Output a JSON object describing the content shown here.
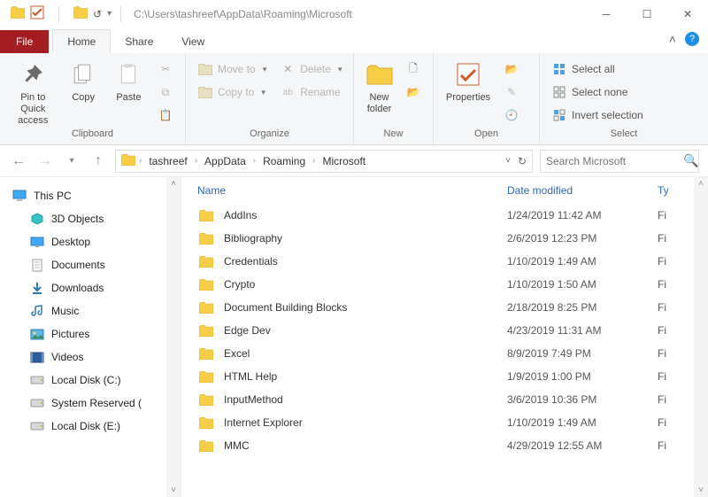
{
  "title_path": "C:\\Users\\tashreef\\AppData\\Roaming\\Microsoft",
  "tabs": {
    "file": "File",
    "home": "Home",
    "share": "Share",
    "view": "View"
  },
  "ribbon": {
    "clipboard": {
      "label": "Clipboard",
      "pin": "Pin to Quick access",
      "copy": "Copy",
      "paste": "Paste"
    },
    "organize": {
      "label": "Organize",
      "moveto": "Move to",
      "copyto": "Copy to",
      "delete": "Delete",
      "rename": "Rename"
    },
    "new": {
      "label": "New",
      "newfolder": "New folder"
    },
    "open": {
      "label": "Open",
      "properties": "Properties"
    },
    "select": {
      "label": "Select",
      "all": "Select all",
      "none": "Select none",
      "invert": "Invert selection"
    }
  },
  "breadcrumb": [
    "tashreef",
    "AppData",
    "Roaming",
    "Microsoft"
  ],
  "search_placeholder": "Search Microsoft",
  "navpane": [
    {
      "label": "This PC",
      "icon": "pc"
    },
    {
      "label": "3D Objects",
      "icon": "3d"
    },
    {
      "label": "Desktop",
      "icon": "desktop"
    },
    {
      "label": "Documents",
      "icon": "docs"
    },
    {
      "label": "Downloads",
      "icon": "downloads"
    },
    {
      "label": "Music",
      "icon": "music"
    },
    {
      "label": "Pictures",
      "icon": "pictures"
    },
    {
      "label": "Videos",
      "icon": "videos"
    },
    {
      "label": "Local Disk (C:)",
      "icon": "disk"
    },
    {
      "label": "System Reserved (",
      "icon": "disk"
    },
    {
      "label": "Local Disk (E:)",
      "icon": "disk"
    }
  ],
  "columns": {
    "name": "Name",
    "date": "Date modified",
    "type": "Ty"
  },
  "files": [
    {
      "name": "AddIns",
      "date": "1/24/2019 11:42 AM",
      "type": "Fi"
    },
    {
      "name": "Bibliography",
      "date": "2/6/2019 12:23 PM",
      "type": "Fi"
    },
    {
      "name": "Credentials",
      "date": "1/10/2019 1:49 AM",
      "type": "Fi"
    },
    {
      "name": "Crypto",
      "date": "1/10/2019 1:50 AM",
      "type": "Fi"
    },
    {
      "name": "Document Building Blocks",
      "date": "2/18/2019 8:25 PM",
      "type": "Fi"
    },
    {
      "name": "Edge Dev",
      "date": "4/23/2019 11:31 AM",
      "type": "Fi"
    },
    {
      "name": "Excel",
      "date": "8/9/2019 7:49 PM",
      "type": "Fi"
    },
    {
      "name": "HTML Help",
      "date": "1/9/2019 1:00 PM",
      "type": "Fi"
    },
    {
      "name": "InputMethod",
      "date": "3/6/2019 10:36 PM",
      "type": "Fi"
    },
    {
      "name": "Internet Explorer",
      "date": "1/10/2019 1:49 AM",
      "type": "Fi"
    },
    {
      "name": "MMC",
      "date": "4/29/2019 12:55 AM",
      "type": "Fi"
    }
  ]
}
